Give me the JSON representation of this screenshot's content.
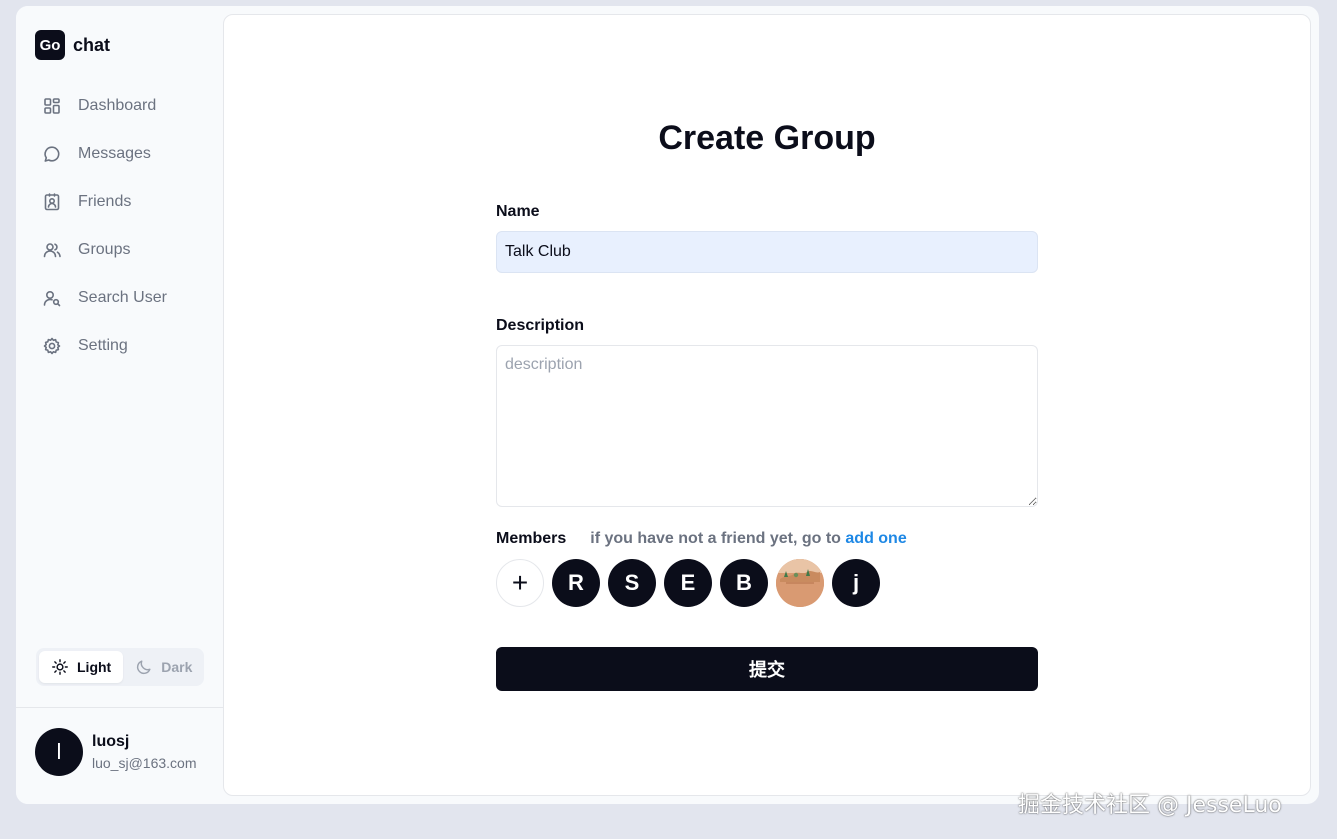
{
  "brand": {
    "logo_text": "Go",
    "name": "chat"
  },
  "sidebar": {
    "items": [
      {
        "label": "Dashboard",
        "icon": "dashboard-icon"
      },
      {
        "label": "Messages",
        "icon": "message-icon"
      },
      {
        "label": "Friends",
        "icon": "contact-icon"
      },
      {
        "label": "Groups",
        "icon": "users-icon"
      },
      {
        "label": "Search User",
        "icon": "user-search-icon"
      },
      {
        "label": "Setting",
        "icon": "gear-icon"
      }
    ],
    "theme": {
      "light_label": "Light",
      "dark_label": "Dark",
      "selected": "Light"
    },
    "profile": {
      "initial": "l",
      "name": "luosj",
      "email": "luo_sj@163.com"
    }
  },
  "form": {
    "title": "Create Group",
    "name_label": "Name",
    "name_value": "Talk Club",
    "description_label": "Description",
    "description_placeholder": "description",
    "members_label": "Members",
    "members_hint": "if you have not a friend yet, go to",
    "members_link": "add one",
    "members": [
      {
        "initial": "R"
      },
      {
        "initial": "S"
      },
      {
        "initial": "E"
      },
      {
        "initial": "B"
      },
      {
        "initial": "",
        "type": "photo"
      },
      {
        "initial": "j"
      }
    ],
    "add_member_symbol": "+",
    "submit_label": "提交"
  },
  "watermark": "掘金技术社区 @ JesseLuo",
  "colors": {
    "primary": "#0b0d1a",
    "link": "#1e88e5",
    "input_filled_bg": "#e8f0fe",
    "muted_text": "#6b7280"
  }
}
